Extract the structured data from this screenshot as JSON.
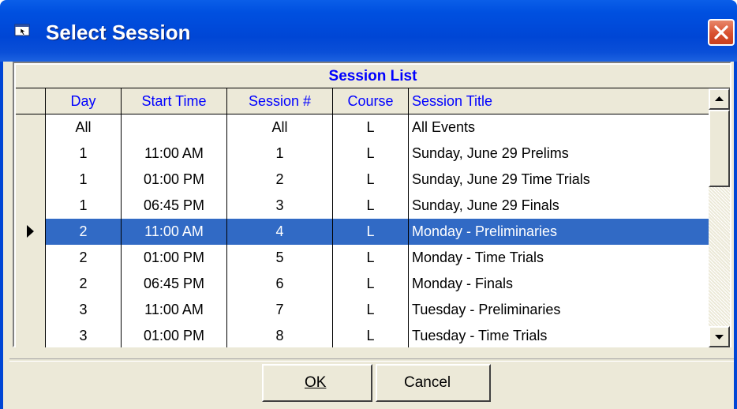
{
  "window": {
    "title": "Select Session"
  },
  "grid": {
    "caption": "Session List",
    "columns": [
      "Day",
      "Start Time",
      "Session #",
      "Course",
      "Session Title"
    ],
    "rows": [
      {
        "day": "All",
        "start": "",
        "session": "All",
        "course": "L",
        "title": "All Events",
        "selected": false
      },
      {
        "day": "1",
        "start": "11:00 AM",
        "session": "1",
        "course": "L",
        "title": "Sunday, June 29 Prelims",
        "selected": false
      },
      {
        "day": "1",
        "start": "01:00 PM",
        "session": "2",
        "course": "L",
        "title": "Sunday, June 29 Time Trials",
        "selected": false
      },
      {
        "day": "1",
        "start": "06:45 PM",
        "session": "3",
        "course": "L",
        "title": "Sunday, June 29 Finals",
        "selected": false
      },
      {
        "day": "2",
        "start": "11:00 AM",
        "session": "4",
        "course": "L",
        "title": "Monday - Preliminaries",
        "selected": true
      },
      {
        "day": "2",
        "start": "01:00 PM",
        "session": "5",
        "course": "L",
        "title": "Monday - Time Trials",
        "selected": false
      },
      {
        "day": "2",
        "start": "06:45 PM",
        "session": "6",
        "course": "L",
        "title": "Monday - Finals",
        "selected": false
      },
      {
        "day": "3",
        "start": "11:00 AM",
        "session": "7",
        "course": "L",
        "title": "Tuesday - Preliminaries",
        "selected": false
      },
      {
        "day": "3",
        "start": "01:00 PM",
        "session": "8",
        "course": "L",
        "title": "Tuesday - Time Trials",
        "selected": false
      }
    ]
  },
  "buttons": {
    "ok": "OK",
    "cancel": "Cancel"
  },
  "icons": {
    "title": "window-icon",
    "close": "close-icon",
    "scroll_up": "scroll-up-arrow-icon",
    "scroll_down": "scroll-down-arrow-icon",
    "row_pointer": "row-pointer-icon"
  },
  "colors": {
    "titlebar": "#0046d5",
    "header_text": "#0000ff",
    "selection": "#316ac5",
    "face": "#ece9d8",
    "close": "#d8502f"
  }
}
